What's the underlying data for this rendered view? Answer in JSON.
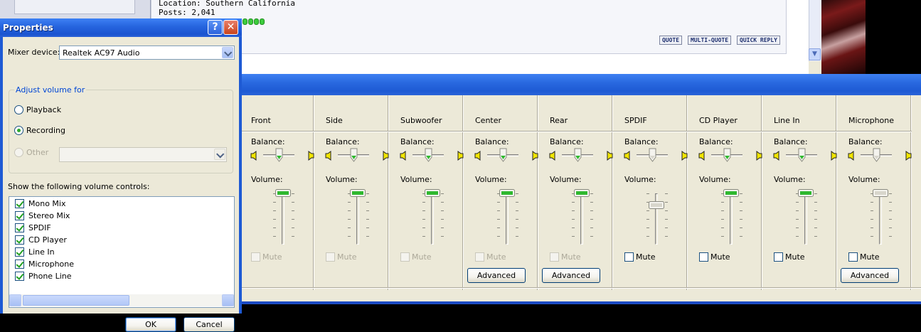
{
  "browser": {
    "location": "Location: Southern California",
    "posts": "Posts: 2,041",
    "buttons": [
      "QUOTE",
      "MULTI-QUOTE",
      "QUICK REPLY"
    ]
  },
  "properties": {
    "title": "Properties",
    "mixer_label": "Mixer device:",
    "mixer_value": "Realtek AC97 Audio",
    "adjust_legend": "Adjust volume for",
    "radios": [
      {
        "label": "Playback",
        "selected": false
      },
      {
        "label": "Recording",
        "selected": true
      },
      {
        "label": "Other",
        "selected": false
      }
    ],
    "show_label": "Show the following volume controls:",
    "controls": [
      "Mono Mix",
      "Stereo Mix",
      "SPDIF",
      "CD Player",
      "Line In",
      "Microphone",
      "Phone Line"
    ],
    "ok_label": "OK",
    "cancel_label": "Cancel"
  },
  "mixer": {
    "balance_label": "Balance:",
    "volume_label": "Volume:",
    "mute_label": "Mute",
    "advanced_label": "Advanced",
    "channels": [
      {
        "name": "Front",
        "mute_enabled": false,
        "advanced": false
      },
      {
        "name": "Side",
        "mute_enabled": false,
        "advanced": false
      },
      {
        "name": "Subwoofer",
        "mute_enabled": false,
        "advanced": false
      },
      {
        "name": "Center",
        "mute_enabled": false,
        "advanced": true
      },
      {
        "name": "Rear",
        "mute_enabled": false,
        "advanced": true
      },
      {
        "name": "SPDIF",
        "mute_enabled": true,
        "advanced": false
      },
      {
        "name": "CD Player",
        "mute_enabled": true,
        "advanced": false
      },
      {
        "name": "Line In",
        "mute_enabled": true,
        "advanced": false
      },
      {
        "name": "Microphone",
        "mute_enabled": true,
        "advanced": true
      }
    ]
  },
  "colors": {
    "xp_blue": "#1e5ad4",
    "dialog_face": "#ece9d8",
    "slider_green": "#21a121"
  }
}
